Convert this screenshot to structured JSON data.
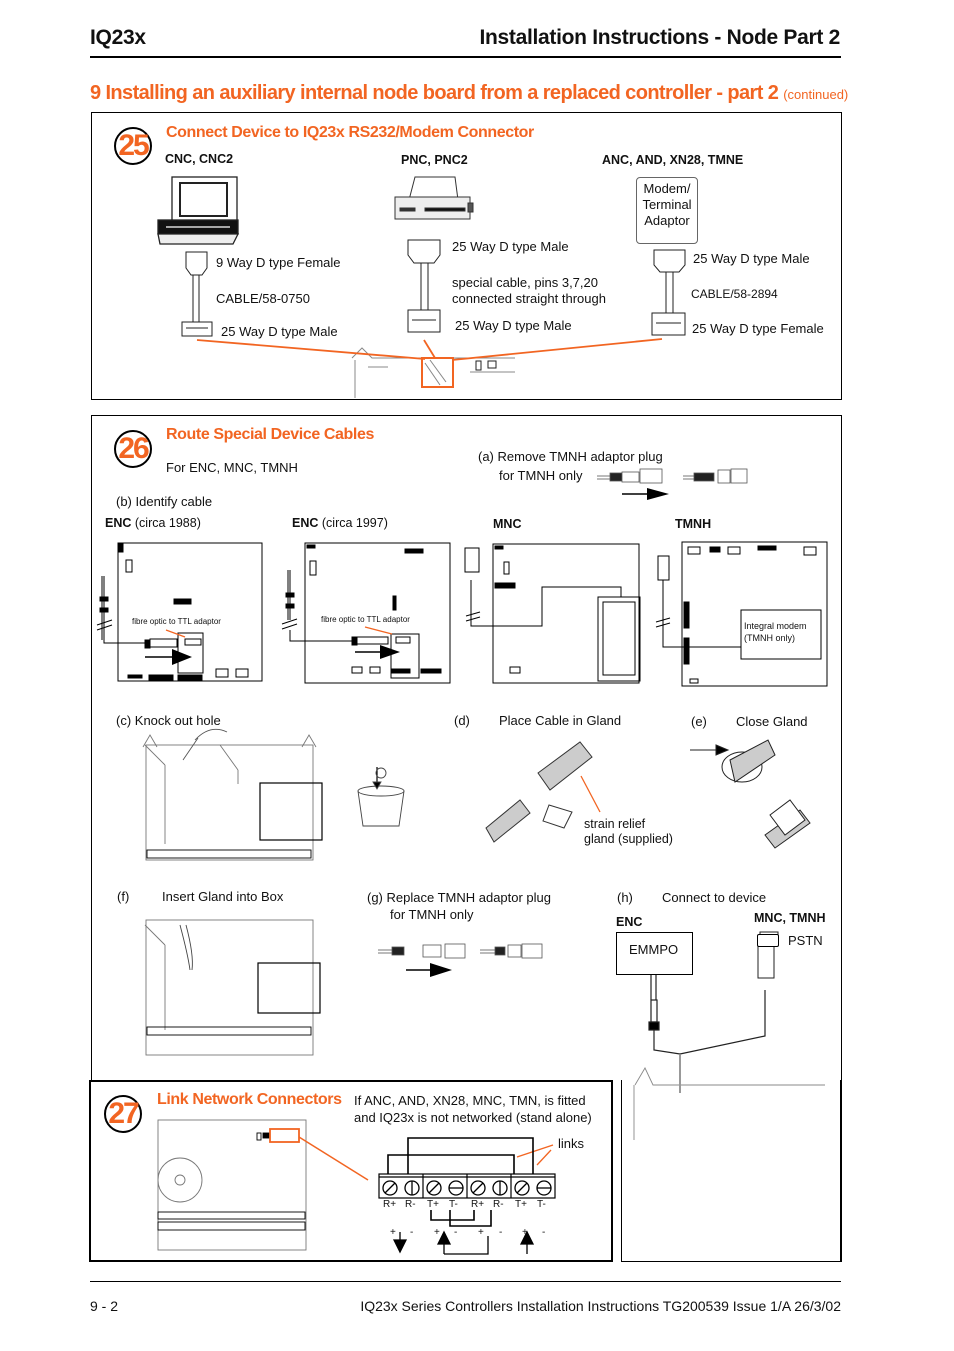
{
  "header": {
    "product": "IQ23x",
    "title": "Installation Instructions - Node Part 2"
  },
  "section": {
    "title": "9 Installing an auxiliary internal node board from a replaced controller - part 2",
    "suffix": "(continued)"
  },
  "step25": {
    "number": "25",
    "heading": "Connect Device to IQ23x RS232/Modem Connector",
    "columns": [
      {
        "label": "CNC, CNC2",
        "device": "computer",
        "top_connector": "9 Way D type Female",
        "cable": "CABLE/58-0750",
        "bottom_connector": "25 Way D type Male"
      },
      {
        "label": "PNC, PNC2",
        "device": "printer",
        "top_connector": "25 Way D type Male",
        "cable_line1": "special cable, pins 3,7,20",
        "cable_line2": "connected straight through",
        "bottom_connector": "25 Way D type Male"
      },
      {
        "label": "ANC, AND, XN28, TMNE",
        "device_lines": [
          "Modem/",
          "Terminal",
          "Adaptor"
        ],
        "top_connector": "25 Way D type Male",
        "cable": "CABLE/58-2894",
        "bottom_connector": "25 Way D type Female"
      }
    ]
  },
  "step26": {
    "number": "26",
    "heading": "Route Special Device Cables",
    "subtitle": "For ENC, MNC, TMNH",
    "a": {
      "line1": "(a) Remove TMNH adaptor plug",
      "line2": "for TMNH only"
    },
    "b": "(b) Identify cable",
    "boards": [
      {
        "label_bold": "ENC",
        "label_rest": " (circa 1988)",
        "callout": "fibre optic to TTL adaptor"
      },
      {
        "label_bold": "ENC",
        "label_rest": " (circa 1997)",
        "callout": "fibre optic to TTL adaptor"
      },
      {
        "label_bold": "MNC",
        "label_rest": ""
      },
      {
        "label_bold": "TMNH",
        "label_rest": "",
        "callout_lines": [
          "Integral modem",
          "(TMNH only)"
        ]
      }
    ],
    "c": "(c) Knock out hole",
    "d": {
      "letter": "(d)",
      "text": "Place Cable in Gland",
      "callout_lines": [
        "strain relief",
        "gland (supplied)"
      ]
    },
    "e": {
      "letter": "(e)",
      "text": "Close Gland"
    },
    "f": {
      "letter": "(f)",
      "text": "Insert Gland into Box"
    },
    "g": {
      "line1": "(g) Replace TMNH adaptor plug",
      "line2": "for TMNH only"
    },
    "h": {
      "letter": "(h)",
      "text": "Connect to device",
      "enc_label": "ENC",
      "enc_device": "EMMPO",
      "mnc_label": "MNC, TMNH",
      "pstn_label": "PSTN"
    }
  },
  "step27": {
    "number": "27",
    "heading": "Link Network Connectors",
    "note_line1": "If ANC, AND, XN28, MNC, TMN, is fitted",
    "note_line2": "and IQ23x is not networked (stand alone)",
    "links_label": "links",
    "terminals": [
      "R+",
      "R-",
      "T+",
      "T-",
      "R+",
      "R-",
      "T+",
      "T-"
    ],
    "polarity": [
      "+",
      "-",
      "+",
      "-",
      "+",
      "-",
      "+",
      "-"
    ]
  },
  "footer": {
    "page": "9 - 2",
    "doc": "IQ23x Series Controllers Installation Instructions TG200539 Issue 1/A 26/3/02"
  },
  "colors": {
    "accent": "#f26522",
    "text": "#111111"
  }
}
